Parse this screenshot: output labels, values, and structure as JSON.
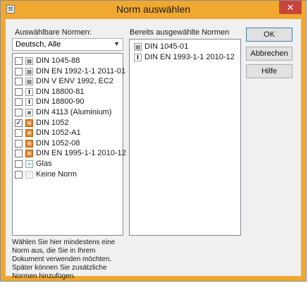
{
  "window": {
    "title": "Norm auswählen",
    "close_glyph": "✕",
    "accent_color": "#f0a830",
    "close_color": "#c7443a"
  },
  "left": {
    "label": "Auswählbare Normen:",
    "filter": "Deutsch, Alle",
    "items": [
      {
        "label": "DIN 1045-88",
        "icon": "grid-icon",
        "checked": false
      },
      {
        "label": "DIN EN 1992-1-1 2011-01",
        "icon": "grid-icon",
        "checked": false
      },
      {
        "label": "DIN V ENV 1992, EC2",
        "icon": "grid-icon",
        "checked": false
      },
      {
        "label": "DIN 18800-81",
        "icon": "steel-profile-icon",
        "checked": false
      },
      {
        "label": "DIN 18800-90",
        "icon": "steel-profile-icon",
        "checked": false
      },
      {
        "label": "DIN 4113 (Aluminium)",
        "icon": "aluminium-profile-icon",
        "checked": false
      },
      {
        "label": "DIN 1052",
        "icon": "timber-icon",
        "checked": true
      },
      {
        "label": "DIN 1052-A1",
        "icon": "timber-icon",
        "checked": false
      },
      {
        "label": "DIN 1052-08",
        "icon": "timber-icon",
        "checked": false
      },
      {
        "label": "DIN EN 1995-1-1 2010-12",
        "icon": "timber-icon",
        "checked": false
      },
      {
        "label": "Glas",
        "icon": "glass-icon",
        "checked": false
      },
      {
        "label": "Keine Norm",
        "icon": "no-norm-icon",
        "checked": false
      }
    ]
  },
  "right": {
    "label": "Bereits ausgewählte Normen",
    "items": [
      {
        "label": "DIN 1045-01",
        "icon": "grid-icon"
      },
      {
        "label": "DIN EN 1993-1-1 2010-12",
        "icon": "steel-profile-icon"
      }
    ]
  },
  "note": "Wählen Sie hier mindestens eine Norm aus, die Sie in Ihrem Dokument verwenden möchten. Später können Sie zusätzliche Normen hinzufügen.",
  "buttons": {
    "ok": "OK",
    "cancel": "Abbrechen",
    "help": "Hilfe"
  }
}
